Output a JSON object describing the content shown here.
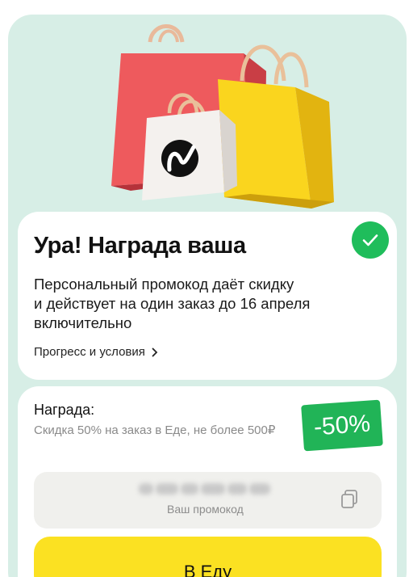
{
  "header": {
    "illustration": "shopping-bags-illustration"
  },
  "reward_card": {
    "title": "Ура! Награда ваша",
    "status_icon": "check-icon",
    "description_lines": [
      "Персональный промокод даёт скидку",
      "и действует на один заказ до 16 апреля",
      "включительно"
    ],
    "terms_link": "Прогресс и условия"
  },
  "reward": {
    "label": "Награда:",
    "description": "Скидка 50% на заказ в Еде, не более 500₽",
    "badge": "-50%"
  },
  "promo": {
    "code": "•••••••••••••",
    "label": "Ваш промокод",
    "copy_icon": "copy-icon"
  },
  "cta": {
    "label": "В Еду"
  },
  "colors": {
    "background": "#d7eee6",
    "success": "#1fbd5b",
    "badge": "#21b457",
    "cta": "#fbe122"
  }
}
